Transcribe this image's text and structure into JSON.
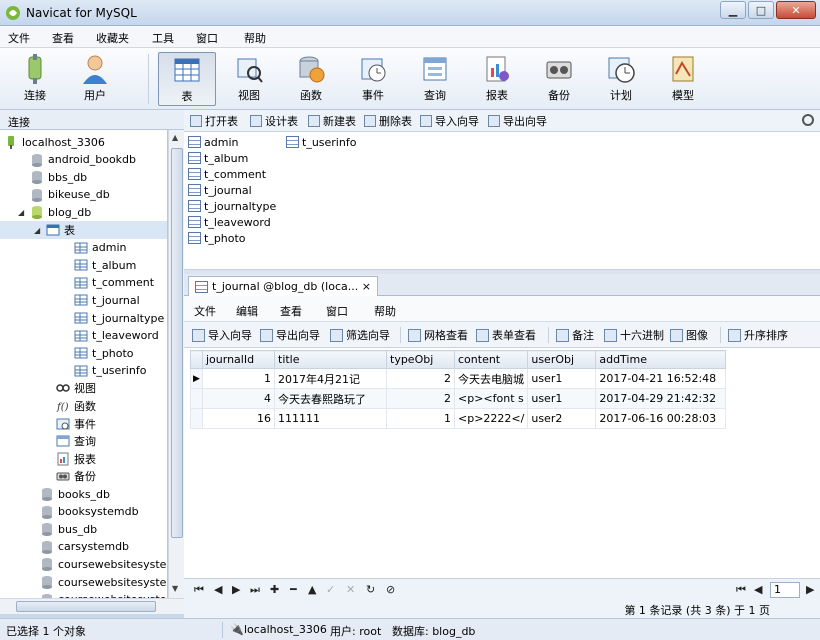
{
  "window": {
    "title": "Navicat for MySQL"
  },
  "menu": [
    "文件",
    "查看",
    "收藏夹",
    "工具",
    "窗口",
    "帮助"
  ],
  "toolbar": [
    "连接",
    "用户",
    "表",
    "视图",
    "函数",
    "事件",
    "查询",
    "报表",
    "备份",
    "计划",
    "模型"
  ],
  "sidebar": {
    "header": "连接",
    "connection": "localhost_3306",
    "databases_before": [
      "android_bookdb",
      "bbs_db",
      "bikeuse_db"
    ],
    "open_db": "blog_db",
    "tables_node": "表",
    "tables": [
      "admin",
      "t_album",
      "t_comment",
      "t_journal",
      "t_journaltype",
      "t_leaveword",
      "t_photo",
      "t_userinfo"
    ],
    "other_nodes": [
      "视图",
      "函数",
      "事件",
      "查询",
      "报表",
      "备份"
    ],
    "databases_after": [
      "books_db",
      "booksystemdb",
      "bus_db",
      "carsystemdb",
      "coursewebsitesyster",
      "coursewebsitesyster",
      "coursewebsitesyster"
    ]
  },
  "object_toolbar": [
    "打开表",
    "设计表",
    "新建表",
    "删除表",
    "导入向导",
    "导出向导"
  ],
  "object_list": [
    "admin",
    "t_album",
    "t_comment",
    "t_journal",
    "t_journaltype",
    "t_leaveword",
    "t_photo",
    "t_userinfo"
  ],
  "tab": {
    "label": "t_journal @blog_db (loca...",
    "close": "×"
  },
  "inner_menu": [
    "文件",
    "编辑",
    "查看",
    "窗口",
    "帮助"
  ],
  "inner_toolbar": [
    "导入向导",
    "导出向导",
    "筛选向导",
    "网格查看",
    "表单查看",
    "备注",
    "十六进制",
    "图像",
    "升序排序"
  ],
  "grid": {
    "columns": [
      "journalId",
      "title",
      "typeObj",
      "content",
      "userObj",
      "addTime"
    ],
    "rows": [
      [
        "1",
        "2017年4月21记",
        "2",
        "今天去电脑城",
        "user1",
        "2017-04-21 16:52:48"
      ],
      [
        "4",
        "今天去春熙路玩了",
        "2",
        "<p><font s",
        "user1",
        "2017-04-29 21:42:32"
      ],
      [
        "16",
        "111111",
        "1",
        "<p>2222</",
        "user2",
        "2017-06-16 00:28:03"
      ]
    ]
  },
  "pager": {
    "page": "1",
    "record_info": "第 1 条记录 (共 3 条) 于 1 页"
  },
  "status": {
    "left": "已选择 1 个对象",
    "connection": "localhost_3306",
    "user": "用户: root",
    "database": "数据库: blog_db"
  },
  "colors": {
    "accent": "#3b6fb6",
    "selection": "#d9e6f5"
  }
}
